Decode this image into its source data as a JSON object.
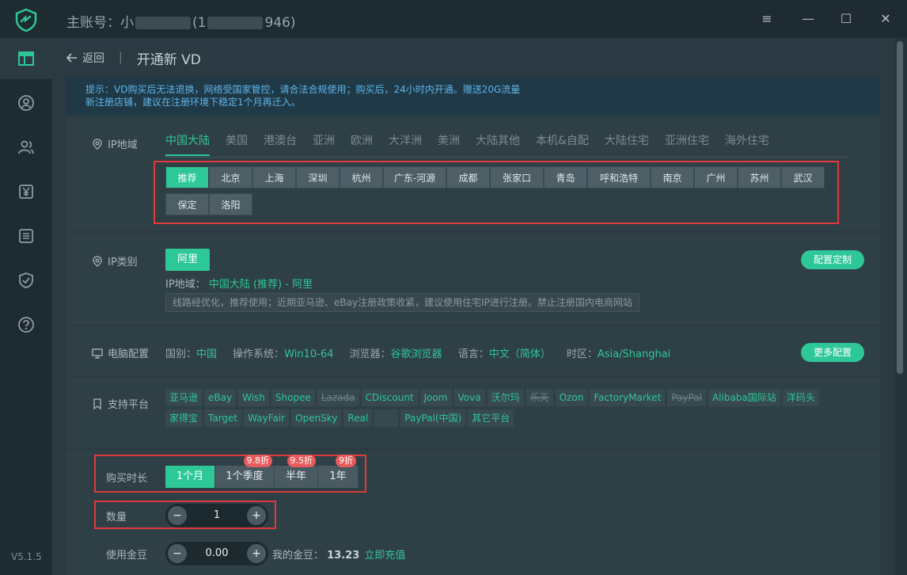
{
  "window": {
    "account_prefix": "主账号：小",
    "account_mid": "(1",
    "account_suffix": "946)",
    "version": "V5.1.5"
  },
  "nav": {
    "back_label": "返回",
    "separator": "|",
    "page_title": "开通新 VD"
  },
  "notice": {
    "line1": "提示：VD购买后无法退换，网络受国家管控，请合法合规使用；购买后，24小时内开通。赠送20G流量",
    "line2": "新注册店铺，建议在注册环境下稳定1个月再迁入。"
  },
  "region": {
    "label": "IP地域",
    "tabs": [
      "中国大陆",
      "美国",
      "港澳台",
      "亚洲",
      "欧洲",
      "大洋洲",
      "美洲",
      "大陆其他",
      "本机&自配",
      "大陆住宅",
      "亚洲住宅",
      "海外住宅"
    ],
    "active_tab": 0,
    "cities_row1": [
      "推荐",
      "北京",
      "上海",
      "深圳",
      "杭州",
      "广东-河源",
      "成都",
      "张家口",
      "青岛",
      "呼和浩特",
      "南京",
      "广州",
      "苏州",
      "武汉"
    ],
    "cities_row2": [
      "保定",
      "洛阳"
    ],
    "active_city": 0
  },
  "iptype": {
    "label": "IP类别",
    "selected": "阿里",
    "region_label": "IP地域：",
    "region_value": "中国大陆 (推荐) - 阿里",
    "hint": "线路经优化，推荐使用；近期亚马逊、eBay注册政策收紧，建议使用住宅IP进行注册。禁止注册国内电商网站",
    "custom_button": "配置定制"
  },
  "pc": {
    "label": "电脑配置",
    "country_k": "国别：",
    "country_v": "中国",
    "os_k": "操作系统：",
    "os_v": "Win10-64",
    "browser_k": "浏览器：",
    "browser_v": "谷歌浏览器",
    "lang_k": "语言：",
    "lang_v": "中文（简体）",
    "tz_k": "时区：",
    "tz_v": "Asia/Shanghai",
    "more_button": "更多配置"
  },
  "platforms": {
    "label": "支持平台",
    "row1": [
      {
        "name": "亚马逊",
        "strike": false
      },
      {
        "name": "eBay",
        "strike": false
      },
      {
        "name": "Wish",
        "strike": false
      },
      {
        "name": "Shopee",
        "strike": false
      },
      {
        "name": "Lazada",
        "strike": true
      },
      {
        "name": "CDiscount",
        "strike": false
      },
      {
        "name": "Joom",
        "strike": false
      },
      {
        "name": "Vova",
        "strike": false
      },
      {
        "name": "沃尔玛",
        "strike": false
      },
      {
        "name": "乐天",
        "strike": true
      },
      {
        "name": "Ozon",
        "strike": false
      },
      {
        "name": "FactoryMarket",
        "strike": false
      },
      {
        "name": "PayPal",
        "strike": true
      },
      {
        "name": "Alibaba国际站",
        "strike": false
      },
      {
        "name": "洋码头",
        "strike": false
      }
    ],
    "row2": [
      {
        "name": "家得宝",
        "strike": false
      },
      {
        "name": "Target",
        "strike": false
      },
      {
        "name": "WayFair",
        "strike": false
      },
      {
        "name": "OpenSky",
        "strike": false
      },
      {
        "name": "Real",
        "strike": false
      },
      {
        "name": "",
        "strike": false
      },
      {
        "name": "PayPal(中国)",
        "strike": false
      },
      {
        "name": "其它平台",
        "strike": false
      }
    ]
  },
  "duration": {
    "label": "购买时长",
    "options": [
      {
        "label": "1个月",
        "discount": ""
      },
      {
        "label": "1个季度",
        "discount": "9.8折"
      },
      {
        "label": "半年",
        "discount": "9.5折"
      },
      {
        "label": "1年",
        "discount": "9折"
      }
    ],
    "active": 0
  },
  "quantity": {
    "label": "数量",
    "minus": "−",
    "plus": "+",
    "value": "1"
  },
  "beans": {
    "label": "使用金豆",
    "minus": "−",
    "plus": "+",
    "value": "0.00",
    "my_label": "我的金豆：",
    "my_value": "13.23",
    "recharge": "立即充值"
  },
  "colors": {
    "accent": "#2ec797",
    "highlight": "#e03a3a",
    "notice_text": "#5fb4e8"
  }
}
